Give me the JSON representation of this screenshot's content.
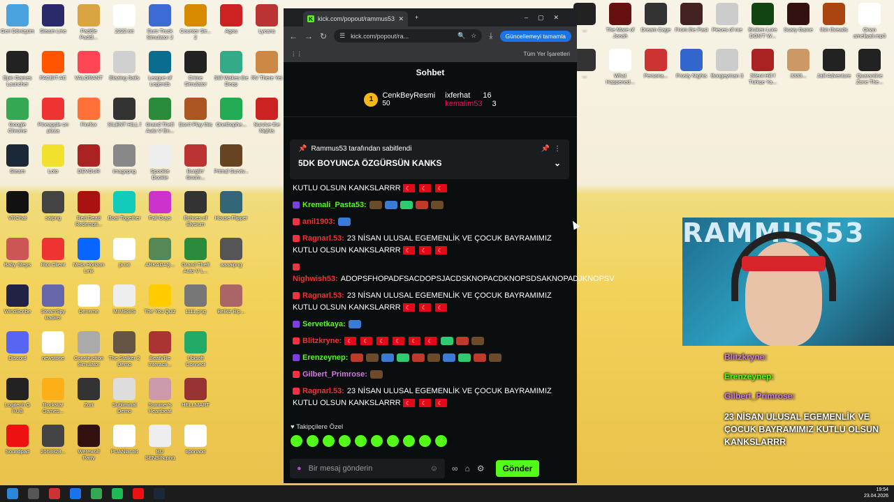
{
  "desktop": {
    "left_icons": [
      {
        "label": "Geri Dönüşüm",
        "color": "#4aa3df"
      },
      {
        "label": "Steam Line",
        "color": "#2a2a6a"
      },
      {
        "label": "Paddle Paddl...",
        "color": "#d9a441"
      },
      {
        "label": "2222.txt",
        "color": "#ffffff"
      },
      {
        "label": "Euro Truck Simulator 2",
        "color": "#3d6bd3"
      },
      {
        "label": "Counter Str... 2",
        "color": "#d68a00"
      },
      {
        "label": "Agou",
        "color": "#c22"
      },
      {
        "label": "Lycans",
        "color": "#b33"
      },
      {
        "label": "Epic Games Launcher",
        "color": "#222"
      },
      {
        "label": "FACEIT AC",
        "color": "#ff5500"
      },
      {
        "label": "VALORANT",
        "color": "#ff4655"
      },
      {
        "label": "Blazing Sails",
        "color": "#d0d0d0"
      },
      {
        "label": "League of Legends",
        "color": "#0a6c8f"
      },
      {
        "label": "Crime Simulator",
        "color": "#222"
      },
      {
        "label": "Still Wakes the Deep",
        "color": "#3a8"
      },
      {
        "label": "RV There Yet",
        "color": "#c84"
      },
      {
        "label": "Google Chrome",
        "color": "#34a853"
      },
      {
        "label": "Pineapple on pizza",
        "color": "#e33"
      },
      {
        "label": "Firefox",
        "color": "#ff7139"
      },
      {
        "label": "SILENT HILL f",
        "color": "#333"
      },
      {
        "label": "Grand Theft Auto V En...",
        "color": "#2a8c3a"
      },
      {
        "label": "Don't Play this",
        "color": "#a52"
      },
      {
        "label": "Onethophe...",
        "color": "#2a5"
      },
      {
        "label": "Survive the Nights",
        "color": "#c22"
      },
      {
        "label": "Steam",
        "color": "#1b2838"
      },
      {
        "label": "Loto",
        "color": "#f1e02c"
      },
      {
        "label": "DEVOUR",
        "color": "#a22"
      },
      {
        "label": "imagepng",
        "color": "#888"
      },
      {
        "label": "Spookie Dookie",
        "color": "#eee"
      },
      {
        "label": "Burglin' Gnom...",
        "color": "#b33"
      },
      {
        "label": "Primal Surviv...",
        "color": "#642"
      },
      {
        "label": "VRChat",
        "color": "#111"
      },
      {
        "label": "saipng",
        "color": "#444"
      },
      {
        "label": "Red Dead Redempti...",
        "color": "#a11"
      },
      {
        "label": "Boat Together",
        "color": "#1cb"
      },
      {
        "label": "Fall Guys",
        "color": "#c3c"
      },
      {
        "label": "Echoes of Elysium",
        "color": "#333"
      },
      {
        "label": "House Flipper",
        "color": "#367"
      },
      {
        "label": "Baby Steps",
        "color": "#c55"
      },
      {
        "label": "Riot Client",
        "color": "#e33"
      },
      {
        "label": "Meta Horizon Link",
        "color": "#0866ff"
      },
      {
        "label": "pi.txt",
        "color": "#fff"
      },
      {
        "label": "ARKADAŞ...",
        "color": "#585"
      },
      {
        "label": "Grand Theft Auto V L...",
        "color": "#2a8c3a"
      },
      {
        "label": "aaaaipng",
        "color": "#555"
      },
      {
        "label": "WindScribe",
        "color": "#224"
      },
      {
        "label": "SteamSpy tracker",
        "color": "#66a"
      },
      {
        "label": "Deneme",
        "color": "#fff"
      },
      {
        "label": "MIMESIS",
        "color": "#eee"
      },
      {
        "label": "The You Quiz",
        "color": "#fc0"
      },
      {
        "label": "1111.png",
        "color": "#777"
      },
      {
        "label": "Belkiz Bip...",
        "color": "#a66"
      },
      {
        "label": "Discord",
        "color": "#5865f2"
      },
      {
        "label": "newstone",
        "color": "#fff"
      },
      {
        "label": "Construction Simulator",
        "color": "#aaa"
      },
      {
        "label": "The Stalker 2 Demo",
        "color": "#654"
      },
      {
        "label": "BeatVRe Interacti...",
        "color": "#a33"
      },
      {
        "label": "Ubisoft Connect",
        "color": "#2a6"
      },
      {
        "label": "Logitech G HUB",
        "color": "#222"
      },
      {
        "label": "Rockstar Games...",
        "color": "#fcaf17"
      },
      {
        "label": "Zort",
        "color": "#333"
      },
      {
        "label": "Subliminal Demo",
        "color": "#ddd"
      },
      {
        "label": "Summer's Heartbeat",
        "color": "#c9a"
      },
      {
        "label": "HELLMART",
        "color": "#933"
      },
      {
        "label": "Soundpad",
        "color": "#e11"
      },
      {
        "label": "2068828...",
        "color": "#444"
      },
      {
        "label": "Werewolf Party",
        "color": "#311"
      },
      {
        "label": "PUANlar.txt",
        "color": "#fff"
      },
      {
        "label": "BU SENSİN.png",
        "color": "#eee"
      },
      {
        "label": "tiponatxt",
        "color": "#fff"
      }
    ],
    "right_icons": [
      {
        "label": "...",
        "color": "#222"
      },
      {
        "label": "The Mare of Jonah",
        "color": "#611"
      },
      {
        "label": "Dream Cage",
        "color": "#333"
      },
      {
        "label": "From the Past",
        "color": "#422"
      },
      {
        "label": "Pieces of me",
        "color": "#ccc"
      },
      {
        "label": "Broken Lore DON'T W...",
        "color": "#141"
      },
      {
        "label": "Scary Game",
        "color": "#311"
      },
      {
        "label": "thin threads",
        "color": "#a41"
      },
      {
        "label": "Onan ameliyati.mp3",
        "color": "#fff"
      },
      {
        "label": "...",
        "color": "#333"
      },
      {
        "label": "What Happened...",
        "color": "#fff"
      },
      {
        "label": "Persona...",
        "color": "#c33"
      },
      {
        "label": "Frosty Nights",
        "color": "#36c"
      },
      {
        "label": "Boogeyman 3",
        "color": "#ccc"
      },
      {
        "label": "Silent Hill f Türkçe Ya...",
        "color": "#a22"
      },
      {
        "label": "3333...",
        "color": "#c96"
      },
      {
        "label": "Jalil Adventure",
        "color": "#222"
      },
      {
        "label": "Quarantine Zone The...",
        "color": "#222"
      }
    ]
  },
  "browser": {
    "tab_title": "kick.com/popout/rammus53/ch...",
    "url": "kick.com/popout/ra...",
    "update_button": "Güncellemeyi tamamla",
    "bookmarks_label": "Tüm Yer İşaretleri"
  },
  "chat": {
    "header": "Sohbet",
    "leaders": [
      {
        "rank": "1",
        "name": "CenkBeyResmi",
        "count": "50"
      },
      {
        "name": "ixferhat",
        "count": "16"
      },
      {
        "name": "kemalim53",
        "count": "3"
      }
    ],
    "pinned_by": "Rammus53 tarafından sabitlendi",
    "pinned_text": "5DK BOYUNCA ÖZGÜRSÜN KANKS",
    "messages": [
      {
        "user": "",
        "user_color": "#ffffff",
        "text": "KUTLU OLSUN KANKSLARRR",
        "flags": 3
      },
      {
        "user": "Kremali_Pasta53:",
        "user_color": "#53fc18",
        "text": "",
        "flags": 0,
        "emotes": 5
      },
      {
        "user": "anil1903:",
        "user_color": "#e33",
        "text": "",
        "flags": 0,
        "emotes": 1
      },
      {
        "user": "Ragnarl.53:",
        "user_color": "#e33",
        "text": "23 NİSAN ULUSAL EGEMENLİK VE ÇOCUK BAYRAMIMIZ KUTLU OLSUN KANKSLARRR",
        "flags": 3
      },
      {
        "user": "Nighwish53:",
        "user_color": "#e33",
        "text": "ADOPSFHOPADFSACDOPSJACDSKNOPACDKNOPSDSAKNOPADJKNOPSV",
        "flags": 0
      },
      {
        "user": "Ragnarl.53:",
        "user_color": "#e33",
        "text": "23 NİSAN ULUSAL EGEMENLİK VE ÇOCUK BAYRAMIMIZ KUTLU OLSUN KANKSLARRR",
        "flags": 3
      },
      {
        "user": "Servetkaya:",
        "user_color": "#53fc18",
        "text": "",
        "flags": 0,
        "emotes": 1
      },
      {
        "user": "Blitzkryne:",
        "user_color": "#e33",
        "text": "",
        "flags": 6,
        "emotes": 3
      },
      {
        "user": "Erenzeynep:",
        "user_color": "#53fc18",
        "text": "",
        "flags": 0,
        "emotes": 10
      },
      {
        "user": "Gilbert_Primrose:",
        "user_color": "#d07be0",
        "text": "",
        "flags": 0,
        "emotes": 1
      },
      {
        "user": "Ragnarl.53:",
        "user_color": "#e33",
        "text": "23 NİSAN ULUSAL EGEMENLİK VE ÇOCUK BAYRAMIMIZ KUTLU OLSUN KANKSLARRR",
        "flags": 3
      }
    ],
    "follower_label": "Takipçilere Özel",
    "input_placeholder": "Bir mesaj gönderin",
    "send_label": "Gönder"
  },
  "overlay": {
    "cam_banner": "RAMMUS53",
    "lines": [
      "Blitzkryne:",
      "Erenzeynep:",
      "Gilbert_Primrose:"
    ],
    "big_text": "23 NİSAN ULUSAL EGEMENLİK VE ÇOCUK BAYRAMIMIZ KUTLU OLSUN KANKSLARRR"
  },
  "taskbar": {
    "time": "19:54",
    "date": "23.04.2026"
  }
}
